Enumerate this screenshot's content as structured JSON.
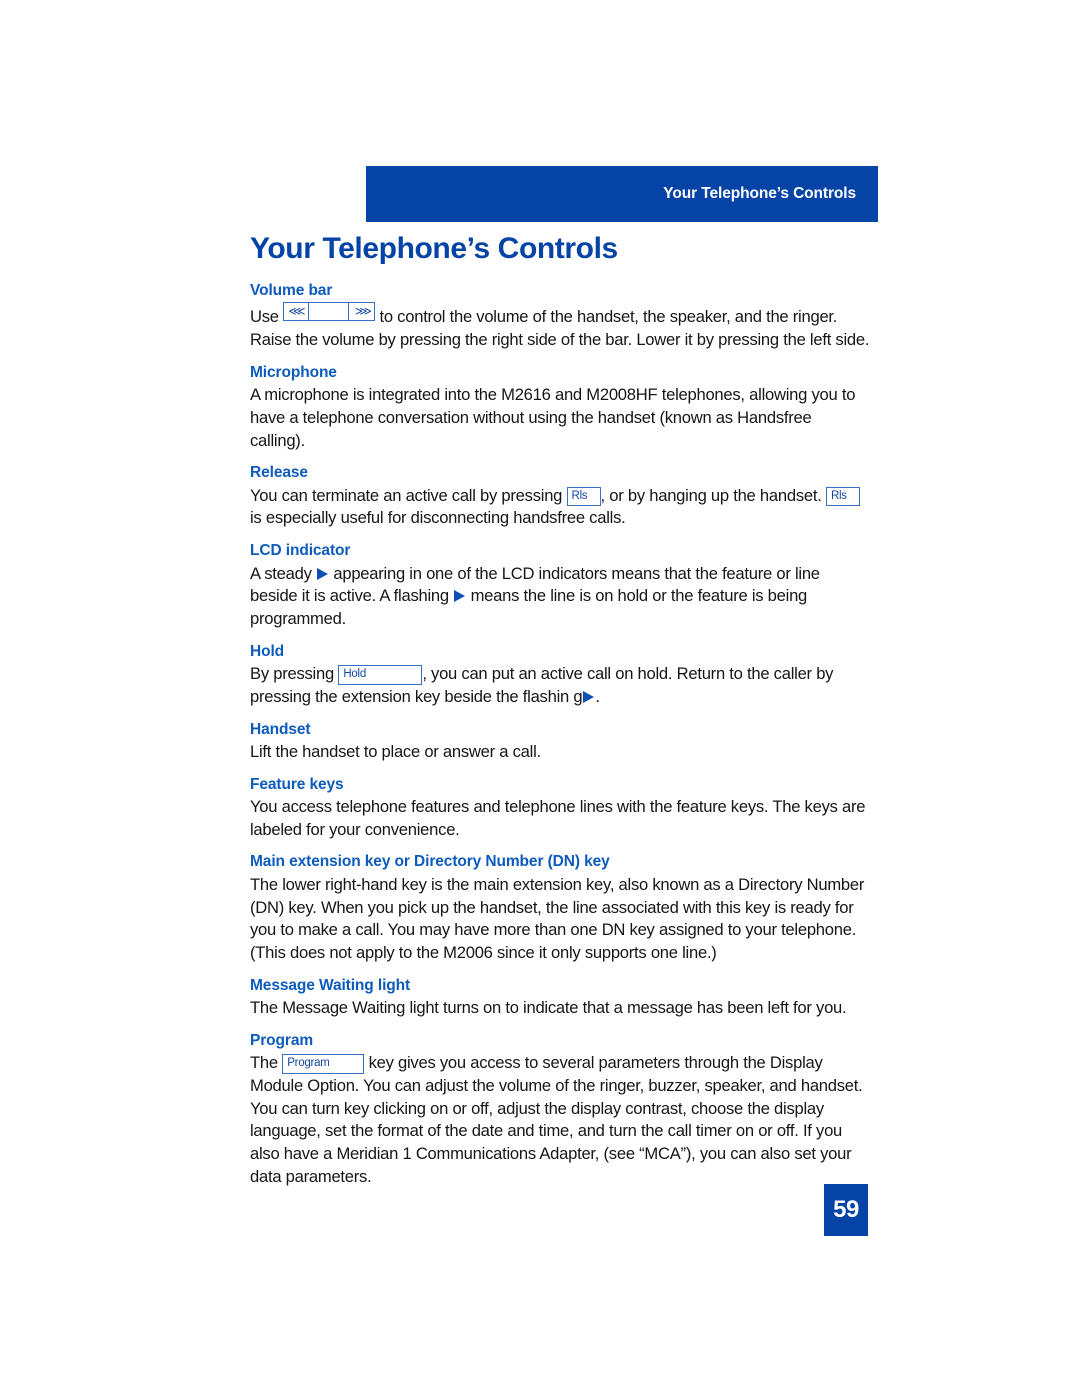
{
  "header": {
    "running_head": "Your Telephone’s Controls"
  },
  "page_title": "Your Telephone’s Controls",
  "sections": [
    {
      "id": "volume-bar",
      "heading": "Volume bar",
      "body_before": "Use ",
      "key_label": "",
      "body_after": " to control the volume of the handset, the speaker, and the ringer. Raise the volume by pressing the right side of the bar. Lower it by pressing the left side."
    },
    {
      "id": "microphone",
      "heading": "Microphone",
      "body": "A microphone is integrated into the M2616 and M2008HF telephones, allowing you to have a telephone conversation without using the handset (known as Handsfree calling)."
    },
    {
      "id": "release",
      "heading": "Release",
      "body_1": "You can terminate an active call by pressing ",
      "key_label": "Rls",
      "body_2": ", or by hanging up the handset. ",
      "body_3": " is especially useful for disconnecting handsfree calls."
    },
    {
      "id": "lcd-indicator",
      "heading": "LCD indicator",
      "body_1": "A steady ",
      "body_2": " appearing in one of the LCD indicators means that the feature or line beside it is active. A flashing ",
      "body_3": " means the line is on hold or the feature is being programmed."
    },
    {
      "id": "hold",
      "heading": "Hold",
      "body_1": "By pressing ",
      "key_label": "Hold",
      "body_2": ", you can put an active call on hold. Return to the caller by pressing the extension key beside the flashin g",
      "body_3": "."
    },
    {
      "id": "handset",
      "heading": "Handset",
      "body": "Lift the handset to place or answer a call."
    },
    {
      "id": "feature-keys",
      "heading": "Feature keys",
      "body": "You access telephone features and telephone lines with the feature keys. The keys are labeled for your convenience."
    },
    {
      "id": "main-extension-key",
      "heading": "Main extension key or Directory Number (DN) key",
      "body": "The lower right-hand key is the main extension key, also known as a Directory Number (DN) key. When you pick up the handset, the line associated with this key is ready for you to make a call. You may have more than one DN key assigned to your telephone. (This does not apply to the M2006 since it only supports one line.)"
    },
    {
      "id": "message-waiting-light",
      "heading": "Message Waiting light",
      "body": "The Message Waiting light turns on to indicate that a message has been left for you."
    },
    {
      "id": "program",
      "heading": "Program",
      "body_1": "The ",
      "key_label": "Program",
      "body_2": " key gives you access to several parameters through the Display Module Option. You can adjust the volume of the ringer, buzzer, speaker, and handset. You can turn key clicking on or off, adjust the display contrast, choose the display language, set the format of the date and time, and turn the call timer on or off. If you also have a Meridian 1 Communications Adapter, (see “MCA”), you can also set your data parameters."
    }
  ],
  "volume_key": {
    "left_glyph": "⋘",
    "right_glyph": "⋙"
  },
  "page_number": "59",
  "colors": {
    "brand_blue": "#0544a6",
    "heading_blue": "#0c5bbd",
    "key_border": "#3a6fc4",
    "key_text": "#12459e",
    "body_text": "#161616"
  }
}
